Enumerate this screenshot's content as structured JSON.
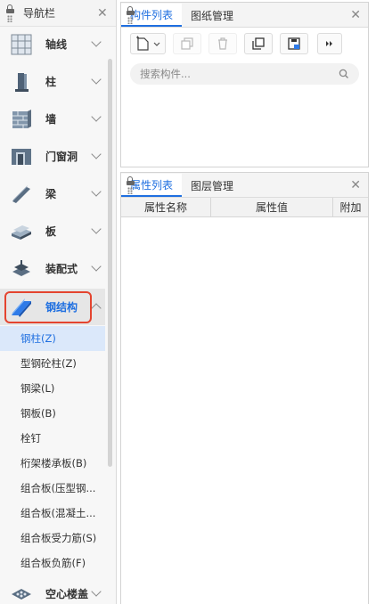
{
  "nav": {
    "title": "导航栏",
    "categories": [
      {
        "label": "轴线",
        "icon": "axis-grid-icon"
      },
      {
        "label": "柱",
        "icon": "column-icon"
      },
      {
        "label": "墙",
        "icon": "wall-icon"
      },
      {
        "label": "门窗洞",
        "icon": "door-window-icon"
      },
      {
        "label": "梁",
        "icon": "beam-icon"
      },
      {
        "label": "板",
        "icon": "slab-icon"
      },
      {
        "label": "装配式",
        "icon": "prefab-icon"
      },
      {
        "label": "钢结构",
        "icon": "steel-structure-icon"
      },
      {
        "label": "空心楼盖",
        "icon": "hollow-floor-icon"
      }
    ],
    "steel_items": [
      "钢柱(Z)",
      "型钢砼柱(Z)",
      "钢梁(L)",
      "钢板(B)",
      "栓钉",
      "桁架楼承板(B)",
      "组合板(压型钢...",
      "组合板(混凝土...",
      "组合板受力筋(S)",
      "组合板负筋(F)"
    ]
  },
  "component_panel": {
    "tabs": [
      "构件列表",
      "图纸管理"
    ],
    "search_placeholder": "搜索构件..."
  },
  "property_panel": {
    "tabs": [
      "属性列表",
      "图层管理"
    ],
    "columns": [
      "属性名称",
      "属性值",
      "附加"
    ]
  },
  "colors": {
    "accent": "#1f6fe0",
    "highlight": "#e4442f",
    "selected_bg": "#dbe8fa"
  }
}
